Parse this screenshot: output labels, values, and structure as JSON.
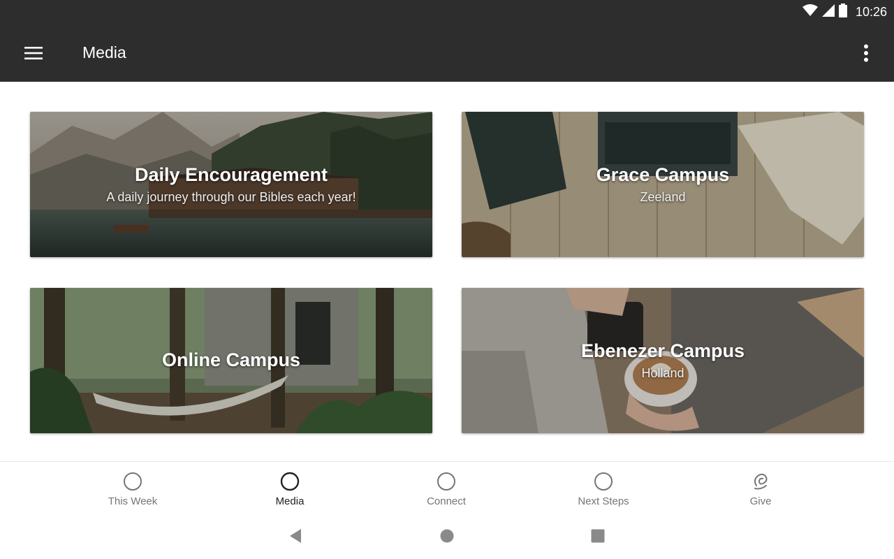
{
  "status_bar": {
    "time": "10:26",
    "icons": [
      "wifi-icon",
      "cellular-icon",
      "battery-icon"
    ]
  },
  "app_bar": {
    "title": "Media",
    "menu_icon": "hamburger-menu-icon",
    "overflow_icon": "more-vert-icon"
  },
  "cards": [
    {
      "title": "Daily Encouragement",
      "subtitle": "A daily journey through our Bibles each year!"
    },
    {
      "title": "Grace Campus",
      "subtitle": "Zeeland"
    },
    {
      "title": "Online Campus",
      "subtitle": ""
    },
    {
      "title": "Ebenezer Campus",
      "subtitle": "Holland"
    }
  ],
  "bottom_nav": {
    "active_index": 1,
    "items": [
      {
        "label": "This Week",
        "icon": "circle-icon"
      },
      {
        "label": "Media",
        "icon": "circle-icon"
      },
      {
        "label": "Connect",
        "icon": "circle-icon"
      },
      {
        "label": "Next Steps",
        "icon": "circle-icon"
      },
      {
        "label": "Give",
        "icon": "give-icon"
      }
    ]
  },
  "system_nav": {
    "icons": [
      "back-icon",
      "home-icon",
      "recents-icon"
    ]
  },
  "colors": {
    "app_bar": "#2d2d2d",
    "nav_active": "#212121",
    "nav_inactive": "#757575"
  }
}
